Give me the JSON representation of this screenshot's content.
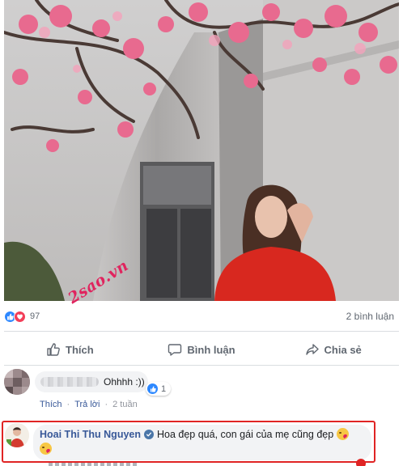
{
  "post": {
    "watermark": "2sao.vn",
    "reaction_count": "97",
    "comments_count": "2 bình luận"
  },
  "actions": {
    "like_label": "Thích",
    "comment_label": "Bình luận",
    "share_label": "Chia sẻ"
  },
  "comments": [
    {
      "text": "Ohhhh :))",
      "like_count": "1",
      "meta": {
        "like": "Thích",
        "reply": "Trả lời",
        "time": "2 tuần"
      }
    },
    {
      "author": "Hoai Thi Thu Nguyen",
      "text": "Hoa đẹp quá, con gái của mẹ cũng đẹp"
    }
  ],
  "icons": [
    "like-reaction-icon",
    "love-reaction-icon",
    "thumbs-up-icon",
    "speech-bubble-icon",
    "share-arrow-icon",
    "verified-badge-icon",
    "kiss-emoji-icon"
  ],
  "colors": {
    "link": "#385898",
    "accent_like": "#2d88ff",
    "accent_love": "#f33e58",
    "highlight_border": "#e02424"
  }
}
